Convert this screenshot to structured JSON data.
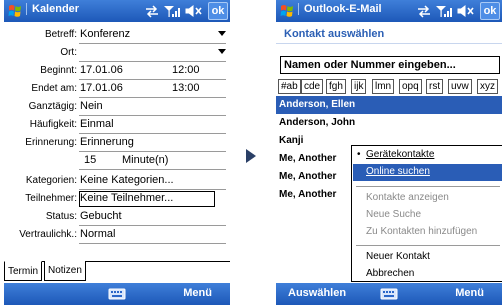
{
  "left": {
    "title": "Kalender",
    "ok_label": "ok",
    "fields": [
      {
        "label": "Betreff:",
        "value": "Konferenz"
      },
      {
        "label": "Ort:",
        "value": ""
      },
      {
        "label": "Beginnt:",
        "value": "17.01.06",
        "value2": "12:00"
      },
      {
        "label": "Endet am:",
        "value": "17.01.06",
        "value2": "13:00"
      },
      {
        "label": "Ganztägig:",
        "value": "Nein"
      },
      {
        "label": "Häufigkeit:",
        "value": "Einmal"
      },
      {
        "label": "Erinnerung:",
        "value": "Erinnerung"
      },
      {
        "label": "",
        "value": "15",
        "value2": "Minute(n)"
      },
      {
        "label": "Kategorien:",
        "value": "Keine Kategorien..."
      },
      {
        "label": "Teilnehmer:",
        "value": "Keine Teilnehmer..."
      },
      {
        "label": "Status:",
        "value": "Gebucht"
      },
      {
        "label": "Vertraulichk.:",
        "value": "Normal"
      }
    ],
    "tabs": [
      "Termin",
      "Notizen"
    ],
    "menu_label": "Menü"
  },
  "right": {
    "title": "Outlook-E-Mail",
    "ok_label": "ok",
    "header": "Kontakt auswählen",
    "search_text": "Namen oder Nummer eingeben...",
    "letters": [
      "#ab",
      "cde",
      "fgh",
      "ijk",
      "lmn",
      "opq",
      "rst",
      "uvw",
      "xyz"
    ],
    "contacts": [
      "Anderson, Ellen",
      "Anderson, John",
      "Kanji",
      "Me, Another",
      "Me, Another",
      "Me, Another"
    ],
    "menu": {
      "device_contacts": "Gerätekontakte",
      "online_search": "Online suchen",
      "show_contacts": "Kontakte anzeigen",
      "new_search": "Neue Suche",
      "add_to_contacts": "Zu Kontakten hinzufügen",
      "new_contact": "Neuer Kontakt",
      "cancel": "Abbrechen"
    },
    "softkey_left": "Auswählen",
    "menu_label": "Menü"
  },
  "icons": {
    "start": "windows-flag-icon",
    "connectivity": "connection-arrows-icon",
    "signal": "signal-strength-icon",
    "volume": "speaker-icon",
    "keyboard": "keyboard-icon",
    "navigation": "right-arrow-icon"
  },
  "colors": {
    "titlebar": "#2a66c8",
    "selection": "#2a5db6",
    "accent_text": "#2b5fb4"
  }
}
